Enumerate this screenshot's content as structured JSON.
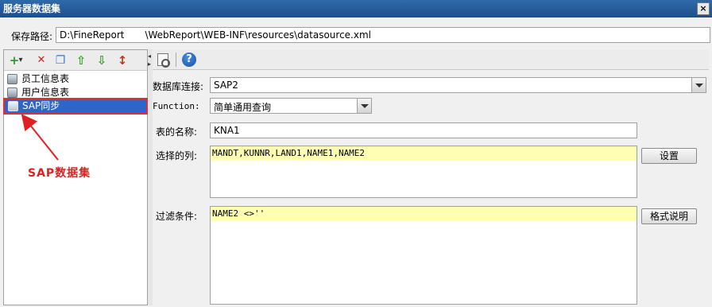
{
  "window": {
    "title": "服务器数据集",
    "close_glyph": "×"
  },
  "save_path": {
    "label": "保存路径:",
    "value_start": "D:\\FineReport",
    "value_end": "\\WebReport\\WEB-INF\\resources\\datasource.xml"
  },
  "left_toolbar": {
    "add": "+",
    "add_dropdown": "▾",
    "delete": "✕",
    "copy": "❐",
    "move_up": "⇧",
    "move_down": "⇩",
    "sort": "↕"
  },
  "datasets": [
    {
      "label": "员工信息表",
      "selected": false
    },
    {
      "label": "用户信息表",
      "selected": false
    },
    {
      "label": "SAP同步",
      "selected": true
    }
  ],
  "annotation": {
    "label": "SAP数据集",
    "color": "#e02020"
  },
  "splitter": {
    "left_arrow": "◂",
    "right_arrow": "▸"
  },
  "right_toolbar": {
    "help": "?"
  },
  "form": {
    "db_connection": {
      "label": "数据库连接:",
      "value": "SAP2"
    },
    "function": {
      "label": "Function:",
      "value": "简单通用查询"
    },
    "table_name": {
      "label": "表的名称:",
      "value": "KNA1"
    },
    "columns": {
      "label": "选择的列:",
      "value": "MANDT,KUNNR,LAND1,NAME1,NAME2",
      "button": "设置"
    },
    "filter": {
      "label": "过滤条件:",
      "value": "NAME2 <>''",
      "button": "格式说明"
    }
  },
  "colors": {
    "selection": "#2f65c8",
    "highlight_line": "#ffffb4",
    "title_bar": "#2f6aa8"
  }
}
